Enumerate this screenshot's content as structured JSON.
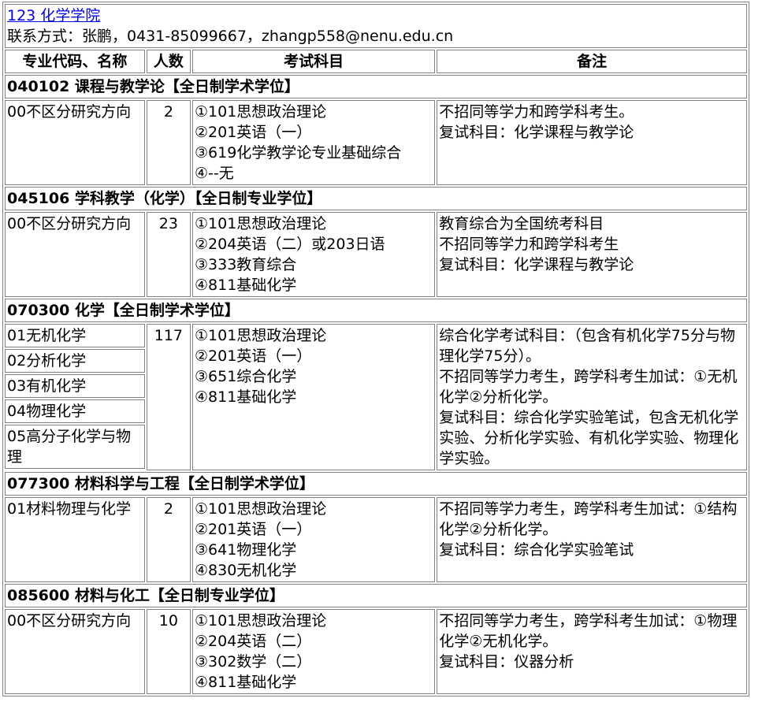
{
  "department": {
    "link_text": "123 化学学院",
    "contact": "联系方式：张鹏，0431-85099667，zhangp558@nenu.edu.cn"
  },
  "headers": [
    "专业代码、名称",
    "人数",
    "考试科目",
    "备注"
  ],
  "sections": [
    {
      "title": "040102 课程与教学论【全日制学术学位】",
      "directions": [
        "00不区分研究方向"
      ],
      "count": "2",
      "subjects": [
        "①101思想政治理论",
        "②201英语（一）",
        "③619化学教学论专业基础综合",
        "④--无"
      ],
      "notes": [
        "不招同等学力和跨学科考生。",
        "复试科目：化学课程与教学论"
      ]
    },
    {
      "title": "045106 学科教学（化学）【全日制专业学位】",
      "directions": [
        "00不区分研究方向"
      ],
      "count": "23",
      "subjects": [
        "①101思想政治理论",
        "②204英语（二）或203日语",
        "③333教育综合",
        "④811基础化学"
      ],
      "notes": [
        "教育综合为全国统考科目",
        "不招同等学力和跨学科考生",
        "复试科目：化学课程与教学论"
      ]
    },
    {
      "title": "070300 化学【全日制学术学位】",
      "directions": [
        "01无机化学",
        "02分析化学",
        "03有机化学",
        "04物理化学",
        "05高分子化学与物理"
      ],
      "count": "117",
      "subjects": [
        "①101思想政治理论",
        "②201英语（一）",
        "③651综合化学",
        "④811基础化学"
      ],
      "notes": [
        "综合化学考试科目：（包含有机化学75分与物理化学75分）。",
        "不招同等学力考生，跨学科考生加试：①无机化学②分析化学。",
        "复试科目：综合化学实验笔试，包含无机化学实验、分析化学实验、有机化学实验、物理化学实验。"
      ]
    },
    {
      "title": "077300 材料科学与工程【全日制学术学位】",
      "directions": [
        "01材料物理与化学"
      ],
      "count": "2",
      "subjects": [
        "①101思想政治理论",
        "②201英语（一）",
        "③641物理化学",
        "④830无机化学"
      ],
      "notes": [
        "不招同等学力考生，跨学科考生加试：①结构化学②分析化学。",
        "复试科目：综合化学实验笔试"
      ]
    },
    {
      "title": "085600 材料与化工【全日制专业学位】",
      "directions": [
        "00不区分研究方向"
      ],
      "count": "10",
      "subjects": [
        "①101思想政治理论",
        "②204英语（二）",
        "③302数学（二）",
        "④811基础化学"
      ],
      "notes": [
        "不招同等学力考生，跨学科考生加试：①物理化学②无机化学。",
        "复试科目：仪器分析"
      ]
    }
  ]
}
